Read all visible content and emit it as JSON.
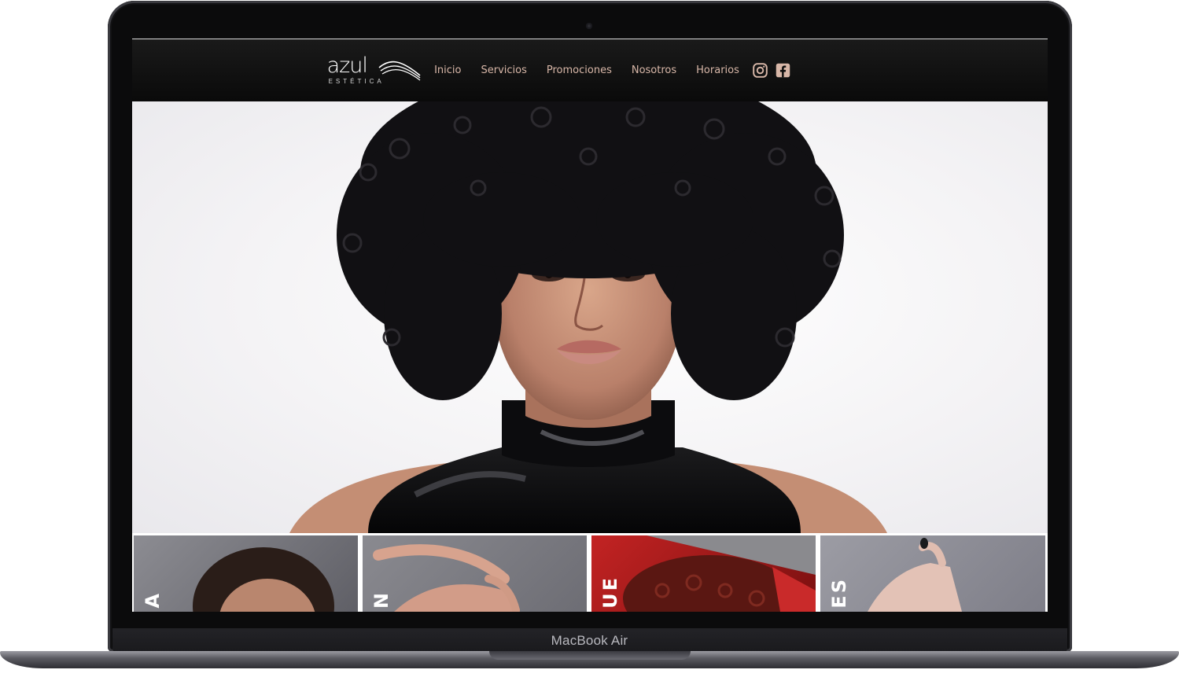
{
  "device": {
    "model_label": "MacBook Air"
  },
  "header": {
    "logo": {
      "brand": "azul",
      "subtitle": "ESTÉTICA"
    },
    "nav": [
      {
        "label": "Inicio"
      },
      {
        "label": "Servicios"
      },
      {
        "label": "Promociones"
      },
      {
        "label": "Nosotros"
      },
      {
        "label": "Horarios"
      }
    ],
    "social": [
      {
        "icon": "instagram-icon"
      },
      {
        "icon": "facebook-icon"
      }
    ],
    "link_color": "#d8b7a8"
  },
  "hero": {
    "image": "portrait of woman with curly black hair wearing black latex top"
  },
  "cards": [
    {
      "label": "A",
      "image": "woman with dark hair"
    },
    {
      "label": "N",
      "image": "reclining arm and shoulder"
    },
    {
      "label": "UE",
      "image": "woman with red curly hair"
    },
    {
      "label": "ES",
      "image": "hand with dark manicure"
    }
  ]
}
